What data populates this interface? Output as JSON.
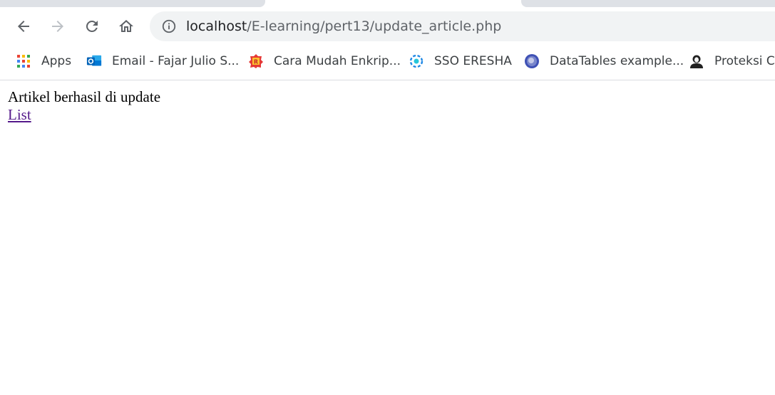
{
  "browser": {
    "address_bar": {
      "host": "localhost",
      "path": "/E-learning/pert13/update_article.php"
    },
    "nav_icons": [
      "back-arrow-icon",
      "forward-arrow-icon",
      "reload-icon",
      "home-icon"
    ],
    "bookmarks": [
      {
        "label": "Apps",
        "icon": "apps-grid-icon"
      },
      {
        "label": "Email - Fajar Julio S...",
        "icon": "outlook-icon"
      },
      {
        "label": "Cara Mudah Enkrip...",
        "icon": "site-favicon-icon"
      },
      {
        "label": "SSO ERESHA",
        "icon": "gear-logo-icon"
      },
      {
        "label": "DataTables example...",
        "icon": "globe-icon"
      },
      {
        "label": "Proteksi CS",
        "icon": "avatar-icon"
      }
    ]
  },
  "page": {
    "message": "Artikel berhasil di update",
    "link_label": "List"
  },
  "colors": {
    "visited_link": "#551a8b",
    "omnibox_bg": "#f1f3f4",
    "tab_bg": "#dee1e6"
  }
}
